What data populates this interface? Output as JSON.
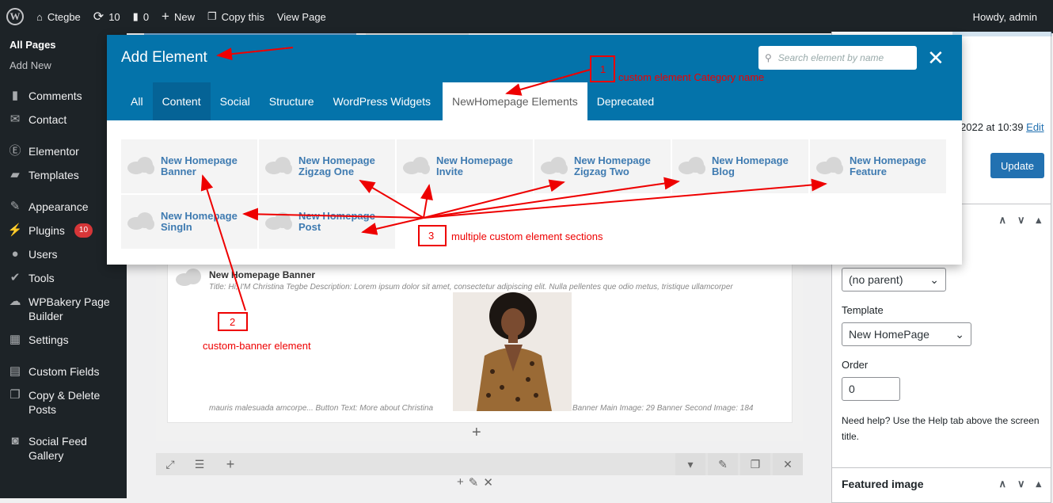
{
  "adminbar": {
    "site": "Ctegbe",
    "updates": "10",
    "comments": "0",
    "new": "New",
    "copy": "Copy this",
    "view": "View Page",
    "howdy": "Howdy, admin"
  },
  "sidebar": {
    "sub": [
      "All Pages",
      "Add New"
    ],
    "items": [
      {
        "label": "Comments",
        "icon": "comment-icon"
      },
      {
        "label": "Contact",
        "icon": "mail-icon"
      },
      {
        "label": "Elementor",
        "icon": "elementor-icon"
      },
      {
        "label": "Templates",
        "icon": "folder-icon"
      },
      {
        "label": "Appearance",
        "icon": "brush-icon"
      },
      {
        "label": "Plugins",
        "icon": "plug-icon",
        "badge": "10"
      },
      {
        "label": "Users",
        "icon": "user-icon"
      },
      {
        "label": "Tools",
        "icon": "wrench-icon"
      },
      {
        "label": "WPBakery Page Builder",
        "icon": "cloud-icon"
      },
      {
        "label": "Settings",
        "icon": "settings-icon"
      },
      {
        "label": "Custom Fields",
        "icon": "table-icon"
      },
      {
        "label": "Copy & Delete Posts",
        "icon": "copy-icon"
      },
      {
        "label": "Social Feed Gallery",
        "icon": "camera-icon"
      }
    ]
  },
  "modal": {
    "title": "Add Element",
    "search_placeholder": "Search element by name",
    "tabs": [
      "All",
      "Content",
      "Social",
      "Structure",
      "WordPress Widgets",
      "NewHomepage Elements",
      "Deprecated"
    ],
    "elements": [
      "New Homepage Banner",
      "New Homepage Zigzag One",
      "New Homepage Invite",
      "New Homepage Zigzag Two",
      "New Homepage Blog",
      "New Homepage Feature",
      "New Homepage SingIn",
      "New Homepage Post"
    ]
  },
  "annotations": {
    "n1": "1",
    "t1": "custom element Category name",
    "n2": "2",
    "t2": "custom-banner element",
    "n3": "3",
    "t3": "multiple custom element sections"
  },
  "banner": {
    "title": "New Homepage Banner",
    "desc": "Title: Hi, I'M Christina Tegbe  Description: Lorem ipsum dolor sit amet, consectetur adipiscing elit. Nulla pellentes que odio metus, tristique ullamcorper",
    "left": "mauris malesuada amcorpe...  Button Text: More about Christina",
    "right": "Banner Main Image: 29  Banner Second Image: 184"
  },
  "right": {
    "date": "2022 at 10:39",
    "edit": "Edit",
    "update": "Update",
    "parent": "(no parent)",
    "template_label": "Template",
    "template": "New HomePage",
    "order_label": "Order",
    "order": "0",
    "help": "Need help? Use the Help tab above the screen title.",
    "featured": "Featured image"
  }
}
